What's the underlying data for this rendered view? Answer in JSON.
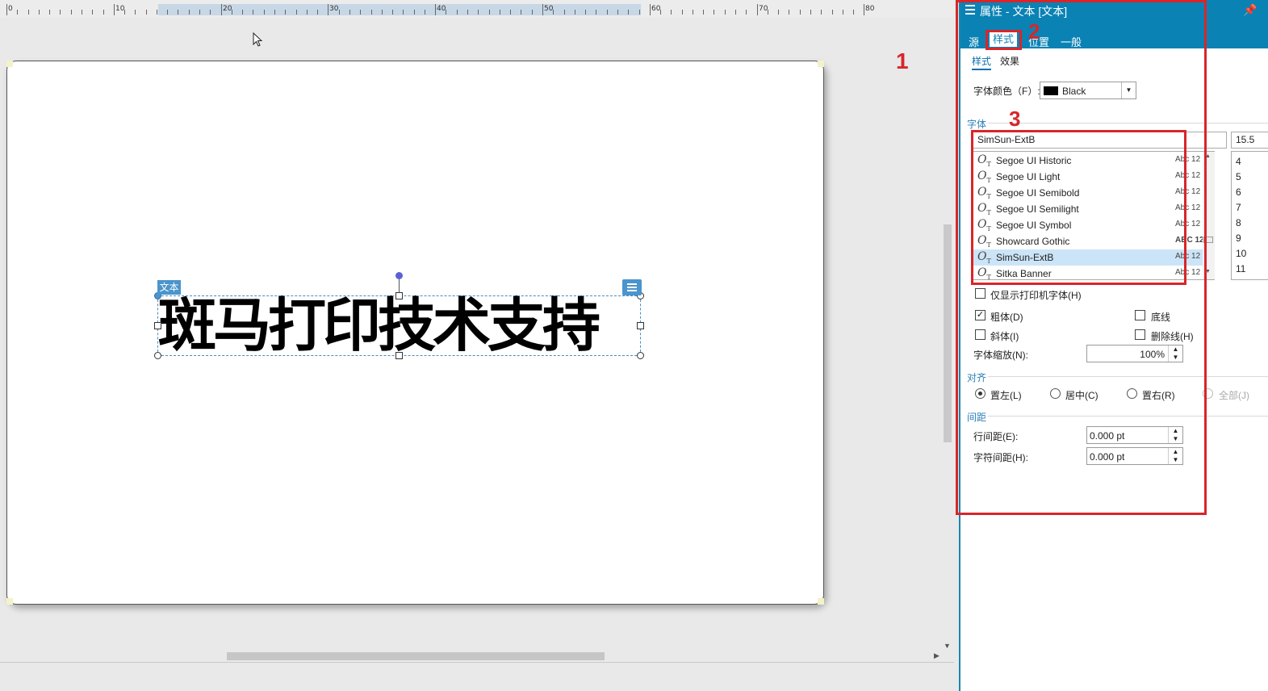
{
  "ruler": {
    "labels": [
      "0",
      "10",
      "20",
      "30",
      "40",
      "50",
      "60",
      "70",
      "80"
    ]
  },
  "canvas": {
    "text_object_tag": "文本",
    "text_content": "斑马打印技术支持"
  },
  "annotations": {
    "num1": "1",
    "num2": "2",
    "num3": "3",
    "color": "#d9252a"
  },
  "panel": {
    "title": "属性 - 文本 [文本]",
    "tabs": [
      "源",
      "样式",
      "位置",
      "一般"
    ],
    "active_tab": "样式",
    "subtabs": [
      "样式",
      "效果"
    ],
    "font_color_label": "字体颜色（F）:",
    "font_color_value": "Black",
    "font_section": "字体",
    "font_name_value": "SimSun-ExtB",
    "font_size_value": "15.5",
    "font_list": [
      {
        "name": "Segoe UI Historic",
        "sample": "Abc 12"
      },
      {
        "name": "Segoe UI Light",
        "sample": "Abc 12"
      },
      {
        "name": "Segoe UI Semibold",
        "sample": "Abc 12"
      },
      {
        "name": "Segoe UI Semilight",
        "sample": "Abc 12"
      },
      {
        "name": "Segoe UI Symbol",
        "sample": "Abc 12"
      },
      {
        "name": "Showcard Gothic",
        "sample": "ABC 12"
      },
      {
        "name": "SimSun-ExtB",
        "sample": "Abc 12"
      },
      {
        "name": "Sitka Banner",
        "sample": "Abc 12"
      }
    ],
    "selected_font": "SimSun-ExtB",
    "size_list": [
      "4",
      "5",
      "6",
      "7",
      "8",
      "9",
      "10",
      "11"
    ],
    "printer_fonts_only": "仅显示打印机字体(H)",
    "bold": "粗体(D)",
    "bold_checked": true,
    "underline": "底线",
    "italic": "斜体(I)",
    "strikethrough": "删除线(H)",
    "font_scale_label": "字体缩放(N):",
    "font_scale_value": "100%",
    "align_section": "对齐",
    "align_options": [
      "置左(L)",
      "居中(C)",
      "置右(R)",
      "全部(J)"
    ],
    "align_selected": "置左(L)",
    "spacing_section": "间距",
    "line_spacing_label": "行间距(E):",
    "line_spacing_value": "0.000 pt",
    "char_spacing_label": "字符间距(H):",
    "char_spacing_value": "0.000 pt"
  }
}
